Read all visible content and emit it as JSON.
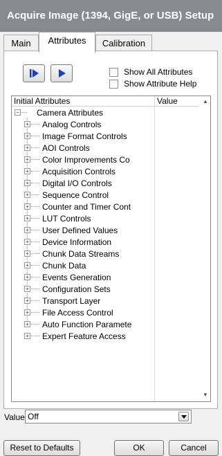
{
  "window": {
    "title": "Acquire Image (1394, GigE, or USB) Setup"
  },
  "tabs": [
    {
      "label": "Main"
    },
    {
      "label": "Attributes",
      "active": true
    },
    {
      "label": "Calibration"
    }
  ],
  "toolbar": {
    "run_button_icon": "step-play-icon",
    "play_button_icon": "play-icon",
    "show_all": {
      "label": "Show All Attributes",
      "checked": false
    },
    "show_help": {
      "label": "Show Attribute Help",
      "checked": false
    }
  },
  "tree": {
    "columns": [
      "Initial Attributes",
      "Value"
    ],
    "root": {
      "label": "Camera Attributes",
      "expanded": true
    },
    "children": [
      "Analog Controls",
      "Image Format Controls",
      "AOI Controls",
      "Color Improvements Co",
      "Acquisition Controls",
      "Digital I/O Controls",
      "Sequence Control",
      "Counter and Timer Cont",
      "LUT Controls",
      "User Defined Values",
      "Device Information",
      "Chunk Data Streams",
      "Chunk Data",
      "Events Generation",
      "Configuration Sets",
      "Transport Layer",
      "File Access Control",
      "Auto Function Paramete",
      "Expert Feature Access"
    ]
  },
  "value": {
    "label": "Value",
    "current": "Off"
  },
  "buttons": {
    "reset": "Reset to Defaults",
    "ok": "OK",
    "cancel": "Cancel"
  }
}
